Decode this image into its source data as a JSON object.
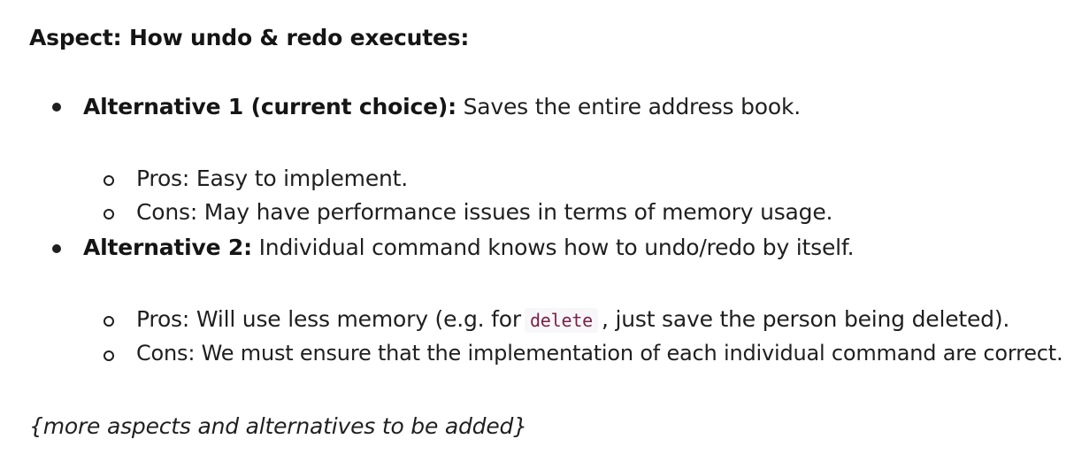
{
  "heading": "Aspect: How undo & redo executes:",
  "alternatives": [
    {
      "name": "Alternative 1 (current choice):",
      "description": " Saves the entire address book.",
      "pros": "Pros: Easy to implement.",
      "cons": "Cons: May have performance issues in terms of memory usage."
    },
    {
      "name": "Alternative 2:",
      "description": " Individual command knows how to undo/redo by itself.",
      "pros_before": "Pros: Will use less memory (e.g. for",
      "pros_code": "delete",
      "pros_after": ", just save the person being deleted).",
      "cons": "Cons: We must ensure that the implementation of each individual command are correct."
    }
  ],
  "footer": "{more aspects and alternatives to be added}"
}
